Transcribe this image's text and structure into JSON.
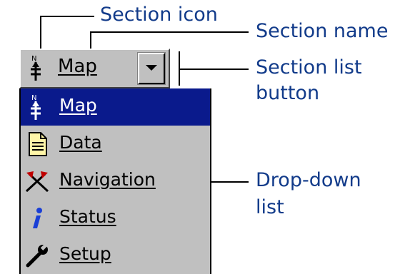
{
  "callouts": {
    "section_icon": "Section icon",
    "section_name": "Section name",
    "section_list_button_line1": "Section list",
    "section_list_button_line2": "button",
    "dropdown_list_line1": "Drop-down",
    "dropdown_list_line2": "list"
  },
  "section_bar": {
    "label": "Map",
    "icon": "north-arrow-icon"
  },
  "dropdown": {
    "items": [
      {
        "label": "Map",
        "icon": "north-arrow-icon",
        "selected": true
      },
      {
        "label": "Data",
        "icon": "document-icon",
        "selected": false
      },
      {
        "label": "Navigation",
        "icon": "crossed-flags-icon",
        "selected": false
      },
      {
        "label": "Status",
        "icon": "info-icon",
        "selected": false
      },
      {
        "label": "Setup",
        "icon": "wrench-icon",
        "selected": false
      }
    ]
  },
  "colors": {
    "callout_text": "#123b8a",
    "selection": "#0a1a8c",
    "face": "#c0c0c0"
  }
}
